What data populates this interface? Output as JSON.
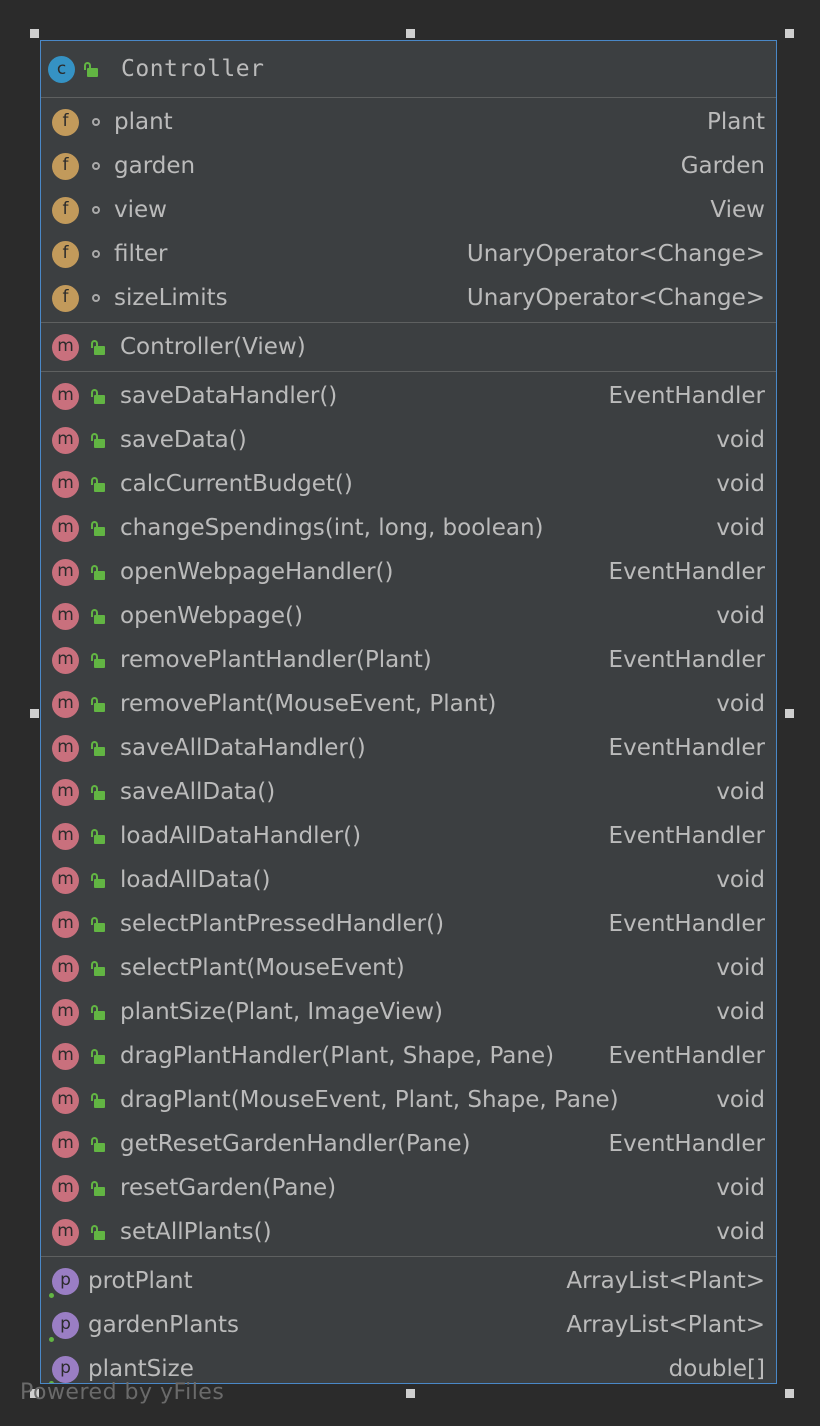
{
  "class": {
    "badge": "c",
    "name": "Controller"
  },
  "fields": [
    {
      "badge": "f",
      "name": "plant",
      "type": "Plant"
    },
    {
      "badge": "f",
      "name": "garden",
      "type": "Garden"
    },
    {
      "badge": "f",
      "name": "view",
      "type": "View"
    },
    {
      "badge": "f",
      "name": "filter",
      "type": "UnaryOperator<Change>"
    },
    {
      "badge": "f",
      "name": "sizeLimits",
      "type": "UnaryOperator<Change>"
    }
  ],
  "constructors": [
    {
      "badge": "m",
      "name": "Controller(View)",
      "type": ""
    }
  ],
  "methods": [
    {
      "badge": "m",
      "name": "saveDataHandler()",
      "type": "EventHandler"
    },
    {
      "badge": "m",
      "name": "saveData()",
      "type": "void"
    },
    {
      "badge": "m",
      "name": "calcCurrentBudget()",
      "type": "void"
    },
    {
      "badge": "m",
      "name": "changeSpendings(int, long, boolean)",
      "type": "void"
    },
    {
      "badge": "m",
      "name": "openWebpageHandler()",
      "type": "EventHandler"
    },
    {
      "badge": "m",
      "name": "openWebpage()",
      "type": "void"
    },
    {
      "badge": "m",
      "name": "removePlantHandler(Plant)",
      "type": "EventHandler"
    },
    {
      "badge": "m",
      "name": "removePlant(MouseEvent, Plant)",
      "type": "void"
    },
    {
      "badge": "m",
      "name": "saveAllDataHandler()",
      "type": "EventHandler"
    },
    {
      "badge": "m",
      "name": "saveAllData()",
      "type": "void"
    },
    {
      "badge": "m",
      "name": "loadAllDataHandler()",
      "type": "EventHandler"
    },
    {
      "badge": "m",
      "name": "loadAllData()",
      "type": "void"
    },
    {
      "badge": "m",
      "name": "selectPlantPressedHandler()",
      "type": "EventHandler"
    },
    {
      "badge": "m",
      "name": "selectPlant(MouseEvent)",
      "type": "void"
    },
    {
      "badge": "m",
      "name": "plantSize(Plant, ImageView)",
      "type": "void"
    },
    {
      "badge": "m",
      "name": "dragPlantHandler(Plant, Shape, Pane)",
      "type": "EventHandler"
    },
    {
      "badge": "m",
      "name": "dragPlant(MouseEvent, Plant, Shape, Pane)",
      "type": "void"
    },
    {
      "badge": "m",
      "name": "getResetGardenHandler(Pane)",
      "type": "EventHandler"
    },
    {
      "badge": "m",
      "name": "resetGarden(Pane)",
      "type": "void"
    },
    {
      "badge": "m",
      "name": "setAllPlants()",
      "type": "void"
    }
  ],
  "properties": [
    {
      "badge": "p",
      "name": "protPlant",
      "type": "ArrayList<Plant>"
    },
    {
      "badge": "p",
      "name": "gardenPlants",
      "type": "ArrayList<Plant>"
    },
    {
      "badge": "p",
      "name": "plantSize",
      "type": "double[]"
    }
  ],
  "watermark": "Powered by yFiles",
  "colors": {
    "background": "#2b2b2b",
    "node_fill": "#3c3f41",
    "node_border": "#4a88c7",
    "class_badge": "#3592c4",
    "field_badge": "#c29a5b",
    "method_badge": "#c9707d",
    "property_badge": "#9a7ec4",
    "public_lock": "#62b543"
  }
}
